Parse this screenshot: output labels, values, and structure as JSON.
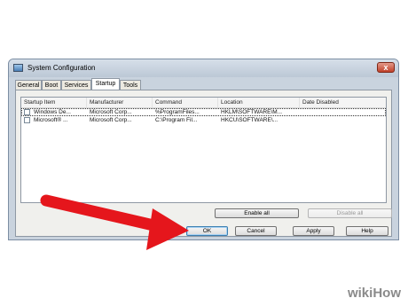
{
  "window": {
    "title": "System Configuration",
    "close_glyph": "x"
  },
  "tabs": [
    "General",
    "Boot",
    "Services",
    "Startup",
    "Tools"
  ],
  "active_tab": "Startup",
  "table": {
    "columns": [
      "Startup Item",
      "Manufacturer",
      "Command",
      "Location",
      "Date Disabled"
    ],
    "rows": [
      {
        "checked": false,
        "cells": [
          "Windows De...",
          "Microsoft Corp...",
          "%ProgramFiles...",
          "HKLM\\SOFTWARE\\M...",
          ""
        ]
      },
      {
        "checked": false,
        "cells": [
          "Microsoft® ...",
          "Microsoft Corp...",
          "C:\\Program Fil...",
          "HKCU\\SOFTWARE\\...",
          ""
        ]
      }
    ]
  },
  "buttons": {
    "enable_all": "Enable all",
    "disable_all": "Disable all",
    "ok": "OK",
    "cancel": "Cancel",
    "apply": "Apply",
    "help": "Help"
  },
  "colors": {
    "arrow": "#e5161c",
    "titlebar": "#c9d3de",
    "accent": "#3c7fb1"
  },
  "watermark": {
    "prefix": "wiki",
    "suffix": "How"
  }
}
